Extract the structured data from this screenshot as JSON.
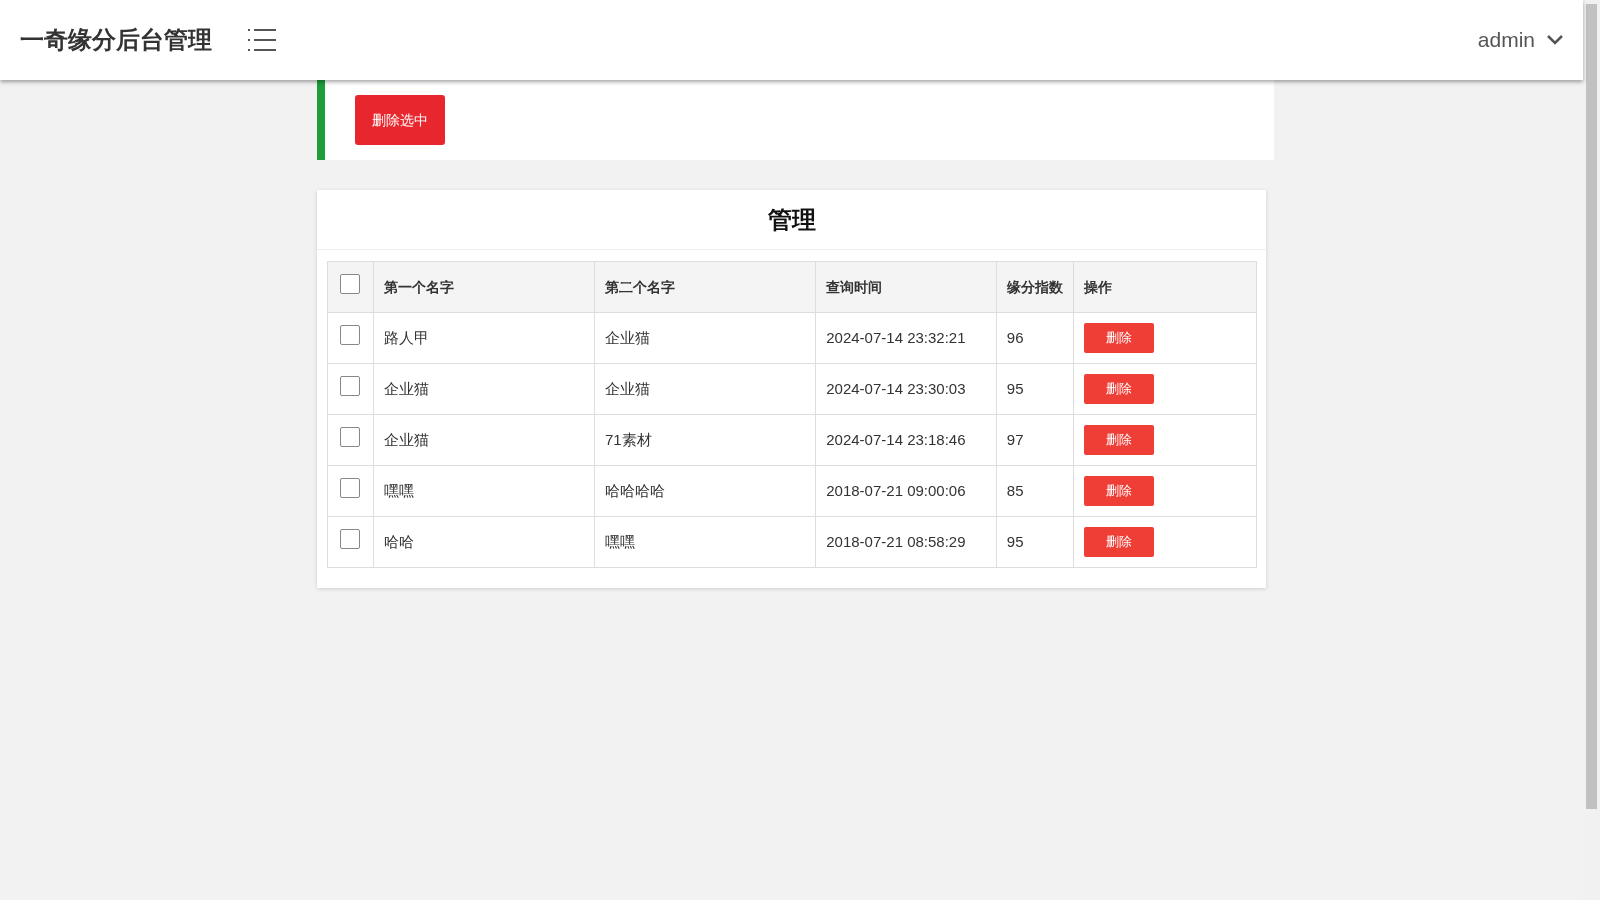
{
  "header": {
    "title": "一奇缘分后台管理",
    "user": "admin"
  },
  "toolbar": {
    "delete_selected_button": "删除选中"
  },
  "panel": {
    "title": "管理",
    "table": {
      "select_all_checked": false,
      "columns": [
        "第一个名字",
        "第二个名字",
        "查询时间",
        "缘分指数",
        "操作"
      ],
      "rows": [
        {
          "checked": false,
          "cells": [
            "路人甲",
            "企业猫",
            "2024-07-14 23:32:21",
            "96"
          ],
          "action": "删除"
        },
        {
          "checked": false,
          "cells": [
            "企业猫",
            "企业猫",
            "2024-07-14 23:30:03",
            "95"
          ],
          "action": "删除"
        },
        {
          "checked": false,
          "cells": [
            "企业猫",
            "71素材",
            "2024-07-14 23:18:46",
            "97"
          ],
          "action": "删除"
        },
        {
          "checked": false,
          "cells": [
            "嘿嘿",
            "哈哈哈哈",
            "2018-07-21 09:00:06",
            "85"
          ],
          "action": "删除"
        },
        {
          "checked": false,
          "cells": [
            "哈哈",
            "嘿嘿",
            "2018-07-21 08:58:29",
            "95"
          ],
          "action": "删除"
        }
      ]
    }
  }
}
